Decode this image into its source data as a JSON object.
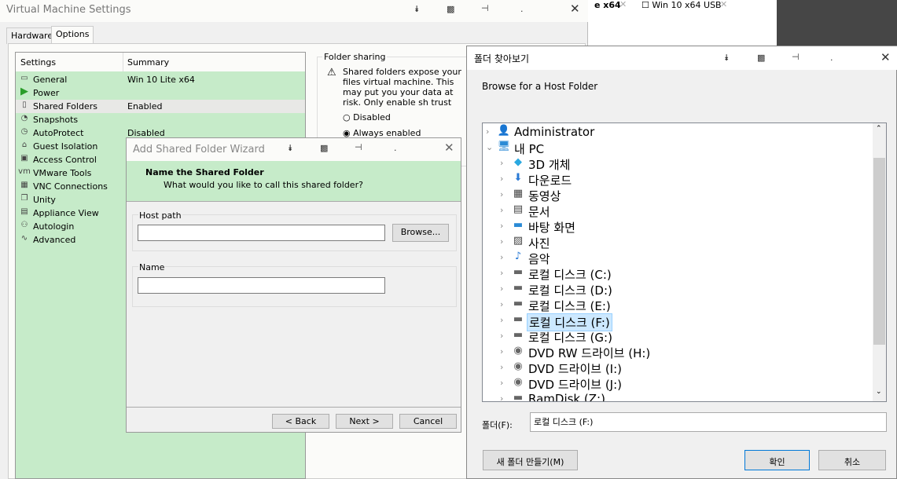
{
  "main": {
    "title": "Virtual Machine Settings",
    "tabs": [
      "Hardware",
      "Options"
    ],
    "columns": {
      "settings": "Settings",
      "summary": "Summary"
    },
    "items": [
      {
        "label": "General",
        "summary": "Win 10 Lite x64",
        "icon": "monitor-icon"
      },
      {
        "label": "Power",
        "summary": "",
        "icon": "play-icon"
      },
      {
        "label": "Shared Folders",
        "summary": "Enabled",
        "icon": "shared-folder-icon"
      },
      {
        "label": "Snapshots",
        "summary": "",
        "icon": "snapshot-icon"
      },
      {
        "label": "AutoProtect",
        "summary": "Disabled",
        "icon": "clock-icon"
      },
      {
        "label": "Guest Isolation",
        "summary": "",
        "icon": "lock-icon"
      },
      {
        "label": "Access Control",
        "summary": "",
        "icon": "access-lock-icon"
      },
      {
        "label": "VMware Tools",
        "summary": "",
        "icon": "vm-icon"
      },
      {
        "label": "VNC Connections",
        "summary": "",
        "icon": "vnc-icon"
      },
      {
        "label": "Unity",
        "summary": "",
        "icon": "unity-icon"
      },
      {
        "label": "Appliance View",
        "summary": "",
        "icon": "appliance-icon"
      },
      {
        "label": "Autologin",
        "summary": "",
        "icon": "users-icon"
      },
      {
        "label": "Advanced",
        "summary": "",
        "icon": "pulse-icon"
      }
    ],
    "folder_sharing": {
      "title": "Folder sharing",
      "warning": "Shared folders expose your files virtual machine. This may put you your data at risk. Only enable sh trust the virtual machine with you",
      "disabled": "Disabled",
      "always": "Always enabled"
    }
  },
  "background_tabs": [
    "e x64",
    "Win 10 x64 USB"
  ],
  "wizard": {
    "title": "Add Shared Folder Wizard",
    "heading": "Name the Shared Folder",
    "subheading": "What would you like to call this shared folder?",
    "host_path_label": "Host path",
    "host_path_value": "",
    "browse": "Browse...",
    "name_label": "Name",
    "name_value": "",
    "back": "< Back",
    "next": "Next >",
    "cancel": "Cancel"
  },
  "browse_dialog": {
    "title": "폴더 찾아보기",
    "description": "Browse for a Host Folder",
    "tree": [
      {
        "label": "Administrator",
        "level": 0,
        "expand": "›",
        "icon": "user-icon"
      },
      {
        "label": "내 PC",
        "level": 0,
        "expand": "⌄",
        "icon": "pc-icon"
      },
      {
        "label": "3D 개체",
        "level": 1,
        "expand": "›",
        "icon": "cube-icon"
      },
      {
        "label": "다운로드",
        "level": 1,
        "expand": "›",
        "icon": "download-icon"
      },
      {
        "label": "동영상",
        "level": 1,
        "expand": "›",
        "icon": "video-icon"
      },
      {
        "label": "문서",
        "level": 1,
        "expand": "›",
        "icon": "document-icon"
      },
      {
        "label": "바탕 화면",
        "level": 1,
        "expand": "›",
        "icon": "desktop-icon"
      },
      {
        "label": "사진",
        "level": 1,
        "expand": "›",
        "icon": "picture-icon"
      },
      {
        "label": "음악",
        "level": 1,
        "expand": "›",
        "icon": "music-icon"
      },
      {
        "label": "로컬 디스크 (C:)",
        "level": 1,
        "expand": "›",
        "icon": "drive-icon"
      },
      {
        "label": "로컬 디스크 (D:)",
        "level": 1,
        "expand": "›",
        "icon": "drive-icon"
      },
      {
        "label": "로컬 디스크 (E:)",
        "level": 1,
        "expand": "›",
        "icon": "drive-icon"
      },
      {
        "label": "로컬 디스크 (F:)",
        "level": 1,
        "expand": "›",
        "icon": "drive-icon",
        "selected": true
      },
      {
        "label": "로컬 디스크 (G:)",
        "level": 1,
        "expand": "›",
        "icon": "drive-icon"
      },
      {
        "label": "DVD RW 드라이브 (H:)",
        "level": 1,
        "expand": "›",
        "icon": "dvd-icon"
      },
      {
        "label": "DVD 드라이브 (I:)",
        "level": 1,
        "expand": "›",
        "icon": "dvd-icon"
      },
      {
        "label": "DVD 드라이브 (J:)",
        "level": 1,
        "expand": "›",
        "icon": "dvd-icon"
      },
      {
        "label": "RamDisk (Z:)",
        "level": 1,
        "expand": "›",
        "icon": "drive-icon"
      }
    ],
    "folder_label": "폴더(F):",
    "folder_value": "로컬 디스크 (F:)",
    "new_folder": "새 폴더 만들기(M)",
    "ok": "확인",
    "cancel": "취소"
  }
}
